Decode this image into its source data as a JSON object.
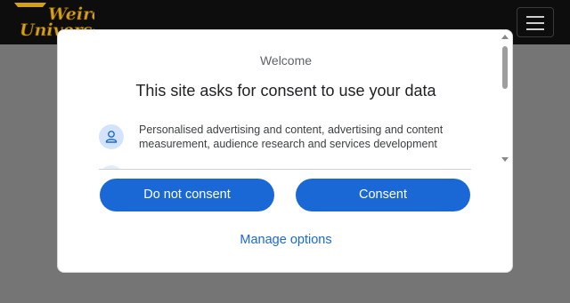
{
  "header": {
    "logo_text_line1": "Weird",
    "logo_text_line2": "Universe",
    "menu_icon": "hamburger-menu-icon"
  },
  "consent_dialog": {
    "eyebrow": "Welcome",
    "title": "This site asks for consent to use your data",
    "purposes": [
      {
        "icon": "person-icon",
        "text": "Personalised advertising and content, advertising and content measurement, audience research and services development"
      }
    ],
    "buttons": {
      "do_not_consent": "Do not consent",
      "consent": "Consent"
    },
    "manage_options": "Manage options"
  },
  "colors": {
    "accent": "#1a68d6",
    "icon_bg": "#d4e3fc",
    "header_bg": "#0d0d0d",
    "overlay": "#757575",
    "logo_gold": "#d4a017"
  }
}
